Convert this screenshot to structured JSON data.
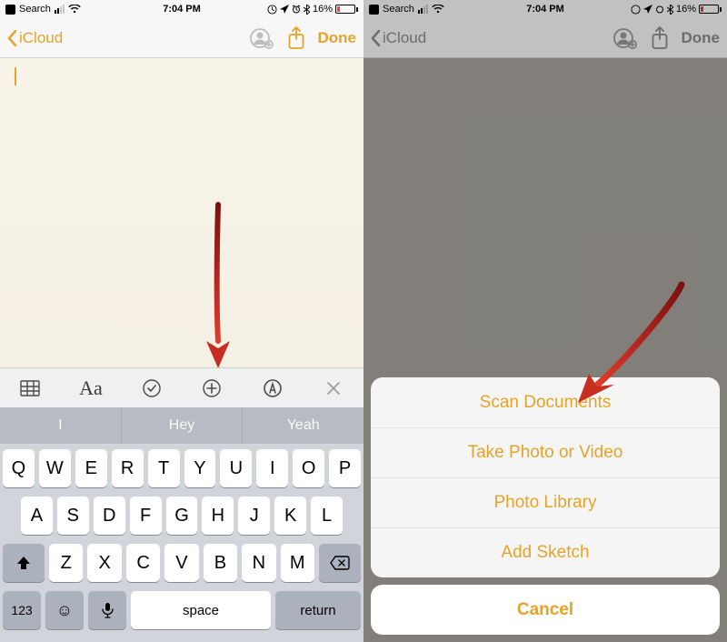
{
  "status": {
    "search_label": "Search",
    "time": "7:04 PM",
    "battery_pct": "16%"
  },
  "nav": {
    "back_label": "iCloud",
    "done_label": "Done"
  },
  "suggestions": {
    "s1": "I",
    "s2": "Hey",
    "s3": "Yeah"
  },
  "format_bar": {
    "aa": "Aa"
  },
  "keyboard": {
    "row1": [
      "Q",
      "W",
      "E",
      "R",
      "T",
      "Y",
      "U",
      "I",
      "O",
      "P"
    ],
    "row2": [
      "A",
      "S",
      "D",
      "F",
      "G",
      "H",
      "J",
      "K",
      "L"
    ],
    "row3": [
      "Z",
      "X",
      "C",
      "V",
      "B",
      "N",
      "M"
    ],
    "num_label": "123",
    "space_label": "space",
    "return_label": "return"
  },
  "action_sheet": {
    "opt1": "Scan Documents",
    "opt2": "Take Photo or Video",
    "opt3": "Photo Library",
    "opt4": "Add Sketch",
    "cancel": "Cancel"
  }
}
